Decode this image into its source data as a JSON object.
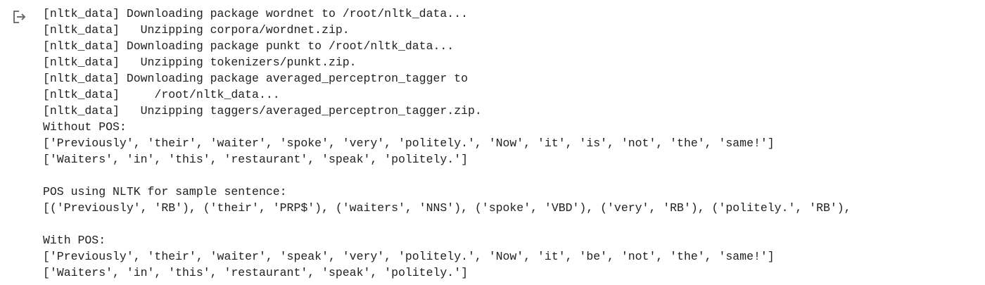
{
  "output": {
    "icon": "output-redirect-icon",
    "lines": [
      "[nltk_data] Downloading package wordnet to /root/nltk_data...",
      "[nltk_data]   Unzipping corpora/wordnet.zip.",
      "[nltk_data] Downloading package punkt to /root/nltk_data...",
      "[nltk_data]   Unzipping tokenizers/punkt.zip.",
      "[nltk_data] Downloading package averaged_perceptron_tagger to",
      "[nltk_data]     /root/nltk_data...",
      "[nltk_data]   Unzipping taggers/averaged_perceptron_tagger.zip.",
      "Without POS:",
      "['Previously', 'their', 'waiter', 'spoke', 'very', 'politely.', 'Now', 'it', 'is', 'not', 'the', 'same!']",
      "['Waiters', 'in', 'this', 'restaurant', 'speak', 'politely.']",
      "",
      "POS using NLTK for sample sentence:",
      "[('Previously', 'RB'), ('their', 'PRP$'), ('waiters', 'NNS'), ('spoke', 'VBD'), ('very', 'RB'), ('politely.', 'RB'),",
      "",
      "With POS:",
      "['Previously', 'their', 'waiter', 'speak', 'very', 'politely.', 'Now', 'it', 'be', 'not', 'the', 'same!']",
      "['Waiters', 'in', 'this', 'restaurant', 'speak', 'politely.']"
    ]
  }
}
